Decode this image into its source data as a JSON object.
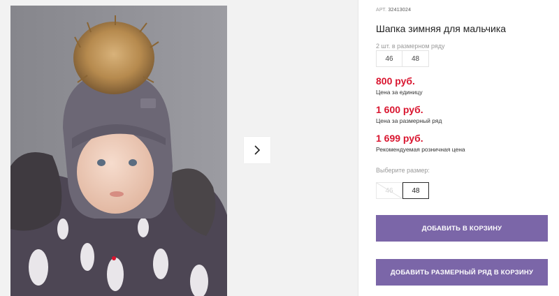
{
  "product": {
    "sku_label": "АРТ.",
    "sku_code": "32413024",
    "title": "Шапка зимняя для мальчика",
    "pack_label": "2 шт. в размерном ряду",
    "pack_sizes": [
      "46",
      "48"
    ]
  },
  "prices": [
    {
      "value": "800 руб.",
      "label": "Цена за единицу"
    },
    {
      "value": "1 600 руб.",
      "label": "Цена за размерный ряд"
    },
    {
      "value": "1 699 руб.",
      "label": "Рекомендуемая розничная цена"
    }
  ],
  "size_select": {
    "label": "Выберите размер:",
    "options": [
      {
        "value": "46",
        "available": false
      },
      {
        "value": "48",
        "available": true,
        "selected": true
      }
    ]
  },
  "actions": {
    "add_to_cart": "ДОБАВИТЬ В КОРЗИНУ",
    "add_size_range": "ДОБАВИТЬ РАЗМЕРНЫЙ РЯД В КОРЗИНУ"
  },
  "colors": {
    "price": "#d9152f",
    "accent": "#7b66a8",
    "hat": "#6c6775",
    "pompom": "#b68a4e",
    "jacket": "#4d4654"
  },
  "icons": {
    "gallery_next": "chevron-right-icon"
  }
}
